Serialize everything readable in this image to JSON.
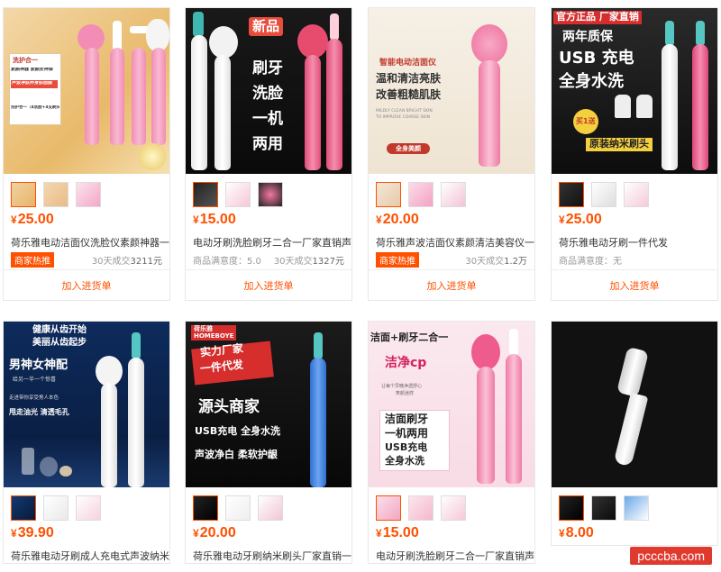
{
  "add_label": "加入进货单",
  "currency": "¥",
  "products": [
    {
      "price": "25.00",
      "title": "荷乐雅电动洁面仪洗脸仪素颜神器一...",
      "badge": "商家热推",
      "left_meta": "",
      "sales_prefix": "30天成交",
      "sales": "3211元",
      "image_text": [
        "洗护合一",
        "素颜神器 素颜女神课",
        "声波净肤养身肤面膜",
        "洗护合一（4洗脸+4支刷头）"
      ],
      "accent": "#f07ab0"
    },
    {
      "price": "15.00",
      "title": "电动牙刷洗脸刷牙二合一厂家直销声...",
      "badge": "",
      "left_meta": "商品满意度：5.0",
      "sales_prefix": "30天成交",
      "sales": "1327元",
      "image_text": [
        "新品",
        "刷牙",
        "洗脸",
        "一机",
        "两用"
      ],
      "accent": "#e74c6f"
    },
    {
      "price": "20.00",
      "title": "荷乐雅声波洁面仪素颜清洁美容仪一...",
      "badge": "商家热推",
      "left_meta": "",
      "sales_prefix": "30天成交",
      "sales": "1.2万",
      "image_text": [
        "智能电动洁面仪",
        "温和清洁亮肤",
        "改善粗糙肌肤",
        "MILDLY CLEAN BRIGHT SKIN",
        "TO IMPROVE COARSE SKIN",
        "全身美颜"
      ],
      "accent": "#f27aa8"
    },
    {
      "price": "25.00",
      "title": "荷乐雅电动牙刷一件代发",
      "badge": "",
      "left_meta": "商品满意度：无",
      "sales_prefix": "",
      "sales": "",
      "image_text": [
        "官方正品",
        "厂家直销",
        "两年质保",
        "USB 充电",
        "全身水洗",
        "原装纳米刷头",
        "买1送"
      ],
      "accent": "#e8467c"
    },
    {
      "price": "39.90",
      "title": "荷乐雅电动牙刷成人充电式声波纳米...",
      "badge": "",
      "left_meta": "",
      "sales_prefix": "",
      "sales": "",
      "image_text": [
        "健康从齿开始",
        "美丽从齿起步",
        "男神女神配",
        "给另一半一个惊喜",
        "走进带你享受男人本色",
        "甩走油光 清透毛孔"
      ],
      "accent": "#ffffff"
    },
    {
      "price": "20.00",
      "title": "荷乐雅电动牙刷纳米刷头厂家直销一...",
      "badge": "",
      "left_meta": "",
      "sales_prefix": "",
      "sales": "",
      "image_text": [
        "荷乐雅",
        "实力厂家",
        "一件代发",
        "源头商家",
        "USB充电 全身水洗",
        "声波净白 柔软护龈"
      ],
      "accent": "#3b7de0"
    },
    {
      "price": "15.00",
      "title": "电动牙刷洗脸刷牙二合一厂家直销声...",
      "badge": "",
      "left_meta": "",
      "sales_prefix": "",
      "sales": "",
      "image_text": [
        "洁面+刷牙二合一",
        "洁净cp",
        "让每个早晚净透舒心",
        "笑颜迷样",
        "洁面刷牙",
        "一机两用",
        "USB充电",
        "全身水洗"
      ],
      "accent": "#f07aa0"
    },
    {
      "price": "8.00",
      "title": "",
      "badge": "",
      "left_meta": "",
      "sales_prefix": "",
      "sales": "",
      "image_text": [],
      "accent": "#f4f4f4"
    }
  ],
  "watermark": "pcccba.com"
}
